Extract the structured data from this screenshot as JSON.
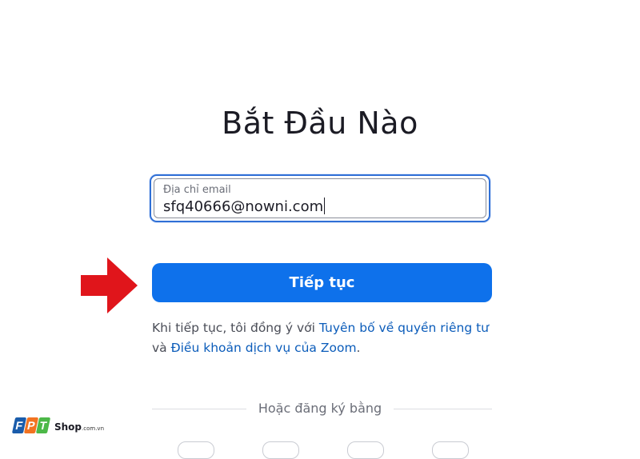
{
  "page": {
    "title": "Bắt Đầu Nào"
  },
  "email_field": {
    "label": "Địa chỉ email",
    "value": "sfq40666@nowni.com"
  },
  "continue_button": {
    "label": "Tiếp tục"
  },
  "terms": {
    "prefix": "Khi tiếp tục, tôi đồng ý với ",
    "privacy_link": "Tuyên bố về quyền riêng tư",
    "conjunction": " và ",
    "tos_link": "Điều khoản dịch vụ của Zoom",
    "suffix": "."
  },
  "divider": {
    "text": "Hoặc đăng ký bằng"
  },
  "watermark": {
    "brand_letters": [
      "F",
      "P",
      "T"
    ],
    "shop": "Shop",
    "domain": ".com.vn"
  },
  "colors": {
    "primary": "#0e71eb",
    "link": "#0b5cba",
    "focus_border": "#2f6fd6",
    "arrow": "#e0151b",
    "fpt_blue": "#1a5cab",
    "fpt_orange": "#f27321",
    "fpt_green": "#4cb848"
  },
  "icons": {
    "arrow": "right-arrow-icon",
    "watermark": "fpt-shop-logo"
  }
}
